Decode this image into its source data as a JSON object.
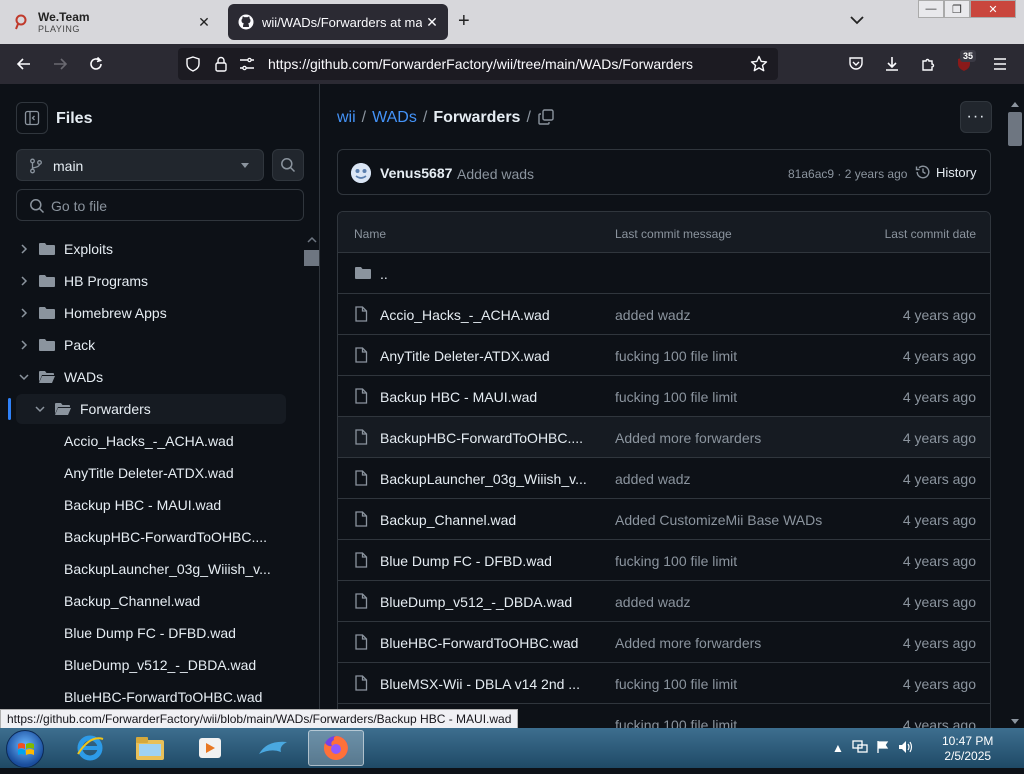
{
  "browser": {
    "tabs": [
      {
        "title": "We.Team",
        "subtitle": "PLAYING",
        "close": "✕"
      },
      {
        "title": "wii/WADs/Forwarders at main",
        "close": "✕"
      }
    ],
    "new_tab": "+",
    "tabs_menu": "⌄",
    "window": {
      "minimize": "—",
      "maximize": "❐",
      "close": "✕"
    },
    "url": "https://github.com/ForwarderFactory/wii/tree/main/WADs/Forwarders",
    "extension_badge": "35",
    "status_url": "https://github.com/ForwarderFactory/wii/blob/main/WADs/Forwarders/Backup HBC - MAUI.wad"
  },
  "sidebar": {
    "title": "Files",
    "branch": "main",
    "search_placeholder": "Go to file",
    "tree": [
      {
        "name": "Exploits",
        "type": "folder",
        "depth": 0,
        "open": false
      },
      {
        "name": "HB Programs",
        "type": "folder",
        "depth": 0,
        "open": false
      },
      {
        "name": "Homebrew Apps",
        "type": "folder",
        "depth": 0,
        "open": false
      },
      {
        "name": "Pack",
        "type": "folder",
        "depth": 0,
        "open": false
      },
      {
        "name": "WADs",
        "type": "folder",
        "depth": 0,
        "open": true
      },
      {
        "name": "Forwarders",
        "type": "folder",
        "depth": 1,
        "open": true,
        "selected": true
      },
      {
        "name": "Accio_Hacks_-_ACHA.wad",
        "type": "file",
        "depth": 2
      },
      {
        "name": "AnyTitle Deleter-ATDX.wad",
        "type": "file",
        "depth": 2
      },
      {
        "name": "Backup HBC - MAUI.wad",
        "type": "file",
        "depth": 2
      },
      {
        "name": "BackupHBC-ForwardToOHBC....",
        "type": "file",
        "depth": 2
      },
      {
        "name": "BackupLauncher_03g_Wiiish_v...",
        "type": "file",
        "depth": 2
      },
      {
        "name": "Backup_Channel.wad",
        "type": "file",
        "depth": 2
      },
      {
        "name": "Blue Dump FC - DFBD.wad",
        "type": "file",
        "depth": 2
      },
      {
        "name": "BlueDump_v512_-_DBDA.wad",
        "type": "file",
        "depth": 2
      },
      {
        "name": "BlueHBC-ForwardToOHBC.wad",
        "type": "file",
        "depth": 2
      }
    ]
  },
  "main": {
    "breadcrumb": {
      "root": "wii",
      "sep": "/",
      "parent": "WADs",
      "current": "Forwarders",
      "trail": "/"
    },
    "more": "···",
    "commit": {
      "author": "Venus5687",
      "message": "Added wads",
      "sha": "81a6ac9",
      "dot": " · ",
      "age": "2 years ago",
      "history": "History"
    },
    "table": {
      "headers": {
        "name": "Name",
        "message": "Last commit message",
        "date": "Last commit date"
      },
      "parent": "..",
      "rows": [
        {
          "name": "Accio_Hacks_-_ACHA.wad",
          "message": "added wadz",
          "date": "4 years ago"
        },
        {
          "name": "AnyTitle Deleter-ATDX.wad",
          "message": "fucking 100 file limit",
          "date": "4 years ago"
        },
        {
          "name": "Backup HBC - MAUI.wad",
          "message": "fucking 100 file limit",
          "date": "4 years ago"
        },
        {
          "name": "BackupHBC-ForwardToOHBC....",
          "message": "Added more forwarders",
          "date": "4 years ago",
          "hover": true
        },
        {
          "name": "BackupLauncher_03g_Wiiish_v...",
          "message": "added wadz",
          "date": "4 years ago"
        },
        {
          "name": "Backup_Channel.wad",
          "message": "Added CustomizeMii Base WADs",
          "date": "4 years ago"
        },
        {
          "name": "Blue Dump FC - DFBD.wad",
          "message": "fucking 100 file limit",
          "date": "4 years ago"
        },
        {
          "name": "BlueDump_v512_-_DBDA.wad",
          "message": "added wadz",
          "date": "4 years ago"
        },
        {
          "name": "BlueHBC-ForwardToOHBC.wad",
          "message": "Added more forwarders",
          "date": "4 years ago"
        },
        {
          "name": "BlueMSX-Wii - DBLA v14 2nd ...",
          "message": "fucking 100 file limit",
          "date": "4 years ago"
        },
        {
          "name": "",
          "message": "fucking 100 file limit",
          "date": "4 years ago"
        }
      ]
    }
  },
  "taskbar": {
    "time": "10:47 PM",
    "date": "2/5/2025",
    "tray_arrow": "▲"
  },
  "colors": {
    "accent": "#4493f8",
    "bg": "#0d1117",
    "border": "#30363d",
    "muted": "#8b949e",
    "folder": "#8b949e"
  }
}
